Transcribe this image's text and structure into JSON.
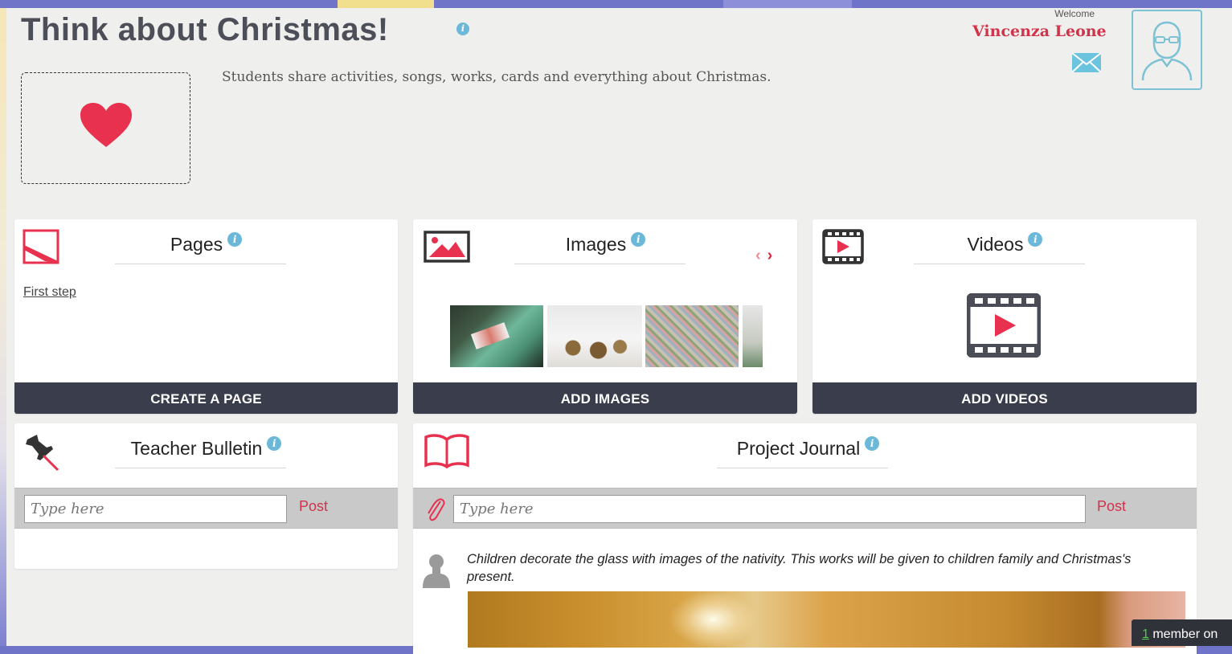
{
  "header": {
    "title": "Think about Christmas!",
    "description": "Students share activities, songs, works, cards and everything about Christmas.",
    "welcome_label": "Welcome",
    "user_name": "Vincenza Leone"
  },
  "cards": {
    "pages": {
      "title": "Pages",
      "items": [
        {
          "label": "First step"
        }
      ],
      "action": "CREATE A PAGE"
    },
    "images": {
      "title": "Images",
      "prev": "‹",
      "next": "›",
      "action": "ADD IMAGES"
    },
    "videos": {
      "title": "Videos",
      "action": "ADD VIDEOS"
    },
    "bulletin": {
      "title": "Teacher Bulletin",
      "placeholder": "Type here",
      "post_label": "Post"
    },
    "journal": {
      "title": "Project Journal",
      "placeholder": "Type here",
      "post_label": "Post",
      "entries": [
        {
          "text": "Children decorate the glass with images of the nativity. This works will be given to children family and Christmas's present."
        }
      ]
    }
  },
  "footer": {
    "members_count": "1",
    "members_label": " member on"
  },
  "colors": {
    "accent": "#d0334a",
    "info": "#6cb8d9",
    "bar": "#3a3d4b"
  }
}
